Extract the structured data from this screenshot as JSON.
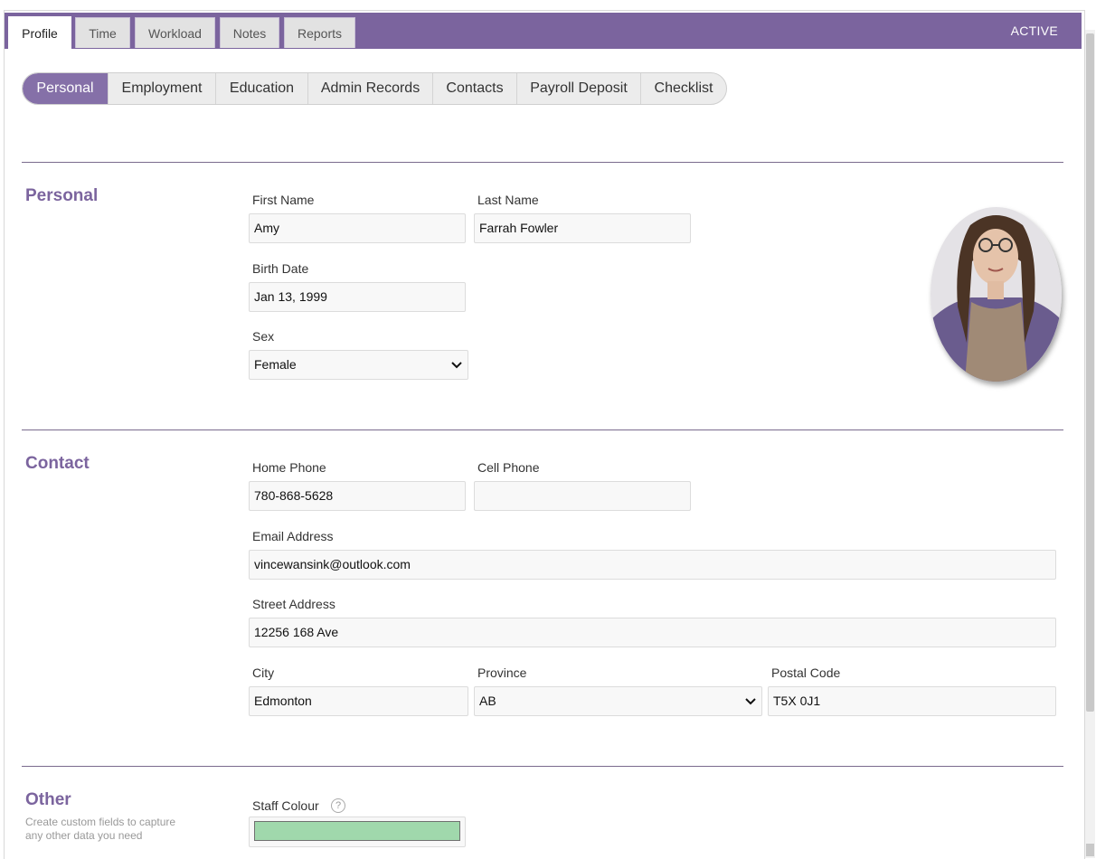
{
  "top_tabs": [
    "Profile",
    "Time",
    "Workload",
    "Notes",
    "Reports"
  ],
  "status": "ACTIVE",
  "sub_tabs": [
    "Personal",
    "Employment",
    "Education",
    "Admin Records",
    "Contacts",
    "Payroll Deposit",
    "Checklist"
  ],
  "personal": {
    "title": "Personal",
    "first_name_label": "First Name",
    "first_name": "Amy",
    "last_name_label": "Last Name",
    "last_name": "Farrah Fowler",
    "birth_date_label": "Birth Date",
    "birth_date": "Jan 13, 1999",
    "sex_label": "Sex",
    "sex": "Female"
  },
  "contact": {
    "title": "Contact",
    "home_phone_label": "Home Phone",
    "home_phone": "780-868-5628",
    "cell_phone_label": "Cell Phone",
    "cell_phone": "",
    "email_label": "Email Address",
    "email": "vincewansink@outlook.com",
    "street_label": "Street Address",
    "street": "12256 168 Ave",
    "city_label": "City",
    "city": "Edmonton",
    "province_label": "Province",
    "province": "AB",
    "postal_label": "Postal Code",
    "postal": "T5X 0J1"
  },
  "other": {
    "title": "Other",
    "description_line1": "Create custom fields to capture",
    "description_line2": "any other data you need",
    "staff_colour_label": "Staff Colour",
    "help_glyph": "?",
    "staff_colour": "#a0d8ac"
  },
  "colors": {
    "accent": "#7b649e",
    "subtab_active": "#8570a8"
  }
}
